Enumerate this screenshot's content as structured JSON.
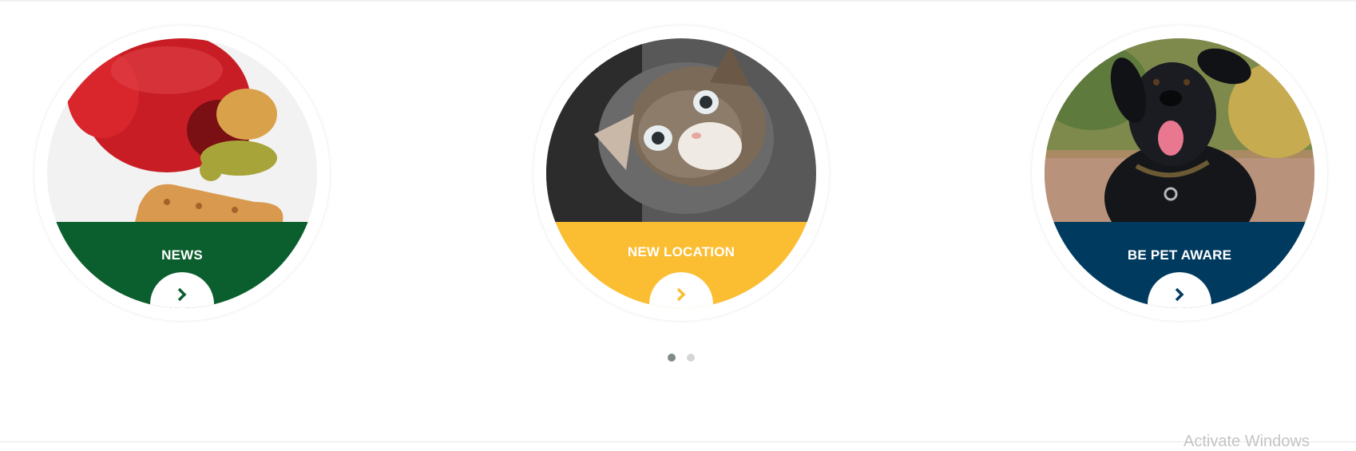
{
  "cards": [
    {
      "title": "NEWS",
      "band_color": "#0b5e2d",
      "image": "kong-toy-with-dog-biscuits"
    },
    {
      "title": "NEW LOCATION",
      "band_color": "#fbbd32",
      "image": "kitten-looking-up"
    },
    {
      "title": "BE PET AWARE",
      "band_color": "#003b5f",
      "image": "black-dog-with-collar"
    }
  ],
  "pagination": {
    "active_color": "#7e8b88",
    "inactive_color": "#d5d7d6"
  },
  "watermark": "Activate Windows"
}
